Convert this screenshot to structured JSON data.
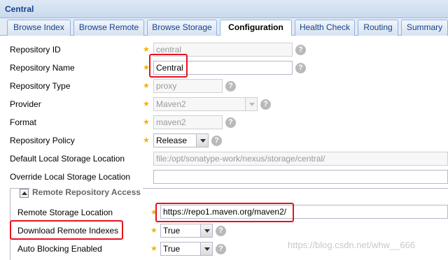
{
  "panel": {
    "title": "Central"
  },
  "tabs": [
    {
      "label": "Browse Index",
      "active": false
    },
    {
      "label": "Browse Remote",
      "active": false
    },
    {
      "label": "Browse Storage",
      "active": false
    },
    {
      "label": "Configuration",
      "active": true
    },
    {
      "label": "Health Check",
      "active": false
    },
    {
      "label": "Routing",
      "active": false
    },
    {
      "label": "Summary",
      "active": false
    }
  ],
  "form": {
    "repo_id": {
      "label": "Repository ID",
      "value": "central"
    },
    "repo_name": {
      "label": "Repository Name",
      "value": "Central"
    },
    "repo_type": {
      "label": "Repository Type",
      "value": "proxy"
    },
    "provider": {
      "label": "Provider",
      "value": "Maven2"
    },
    "format": {
      "label": "Format",
      "value": "maven2"
    },
    "policy": {
      "label": "Repository Policy",
      "value": "Release"
    },
    "default_storage": {
      "label": "Default Local Storage Location",
      "value": "file:/opt/sonatype-work/nexus/storage/central/"
    },
    "override_storage": {
      "label": "Override Local Storage Location",
      "value": ""
    }
  },
  "remote": {
    "legend": "Remote Repository Access",
    "storage_location": {
      "label": "Remote Storage Location",
      "value": "https://repo1.maven.org/maven2/"
    },
    "download_indexes": {
      "label": "Download Remote Indexes",
      "value": "True"
    },
    "auto_blocking": {
      "label": "Auto Blocking Enabled",
      "value": "True"
    }
  },
  "icons": {
    "required": "required-star-icon",
    "help": "help-icon"
  },
  "colors": {
    "highlight": "#e8121f",
    "required": "#f0b400",
    "title": "#15428b"
  },
  "watermark": "https://blog.csdn.net/whw__666"
}
